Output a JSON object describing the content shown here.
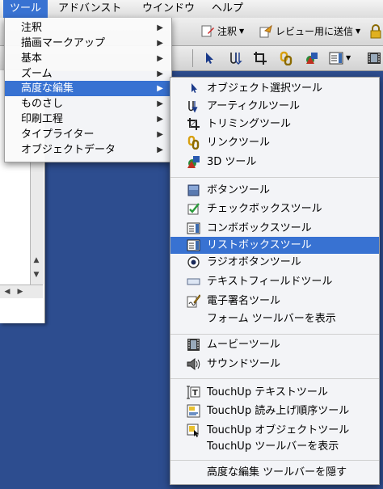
{
  "menubar": {
    "items": [
      {
        "label": "ツール"
      },
      {
        "label": "アドバンスト"
      },
      {
        "label": "ウインドウ"
      },
      {
        "label": "ヘルプ"
      }
    ]
  },
  "toolbar": {
    "annotations_label": "注釈",
    "send_review_label": "レビュー用に送信"
  },
  "tools_menu": {
    "items": [
      {
        "label": "注釈"
      },
      {
        "label": "描画マークアップ"
      },
      {
        "label": "基本"
      },
      {
        "label": "ズーム"
      },
      {
        "label": "高度な編集"
      },
      {
        "label": "ものさし"
      },
      {
        "label": "印刷工程"
      },
      {
        "label": "タイプライター"
      },
      {
        "label": "オブジェクトデータ"
      }
    ]
  },
  "advanced_editing_submenu": {
    "group1": [
      {
        "label": "オブジェクト選択ツール",
        "icon": "object-select-icon"
      },
      {
        "label": "アーティクルツール",
        "icon": "article-icon"
      },
      {
        "label": "トリミングツール",
        "icon": "crop-icon"
      },
      {
        "label": "リンクツール",
        "icon": "link-icon"
      },
      {
        "label": "3D ツール",
        "icon": "3d-icon"
      }
    ],
    "group2": [
      {
        "label": "ボタンツール",
        "icon": "button-tool-icon"
      },
      {
        "label": "チェックボックスツール",
        "icon": "checkbox-tool-icon"
      },
      {
        "label": "コンボボックスツール",
        "icon": "combobox-tool-icon"
      },
      {
        "label": "リストボックスツール",
        "icon": "listbox-tool-icon"
      },
      {
        "label": "ラジオボタンツール",
        "icon": "radio-button-tool-icon"
      },
      {
        "label": "テキストフィールドツール",
        "icon": "text-field-tool-icon"
      },
      {
        "label": "電子署名ツール",
        "icon": "digital-signature-icon"
      },
      {
        "label": "フォーム ツールバーを表示"
      }
    ],
    "group3": [
      {
        "label": "ムービーツール",
        "icon": "movie-icon"
      },
      {
        "label": "サウンドツール",
        "icon": "sound-icon"
      }
    ],
    "group4": [
      {
        "label": "TouchUp テキストツール",
        "icon": "touchup-text-icon"
      },
      {
        "label": "TouchUp 読み上げ順序ツール",
        "icon": "touchup-reading-order-icon"
      },
      {
        "label": "TouchUp オブジェクトツール",
        "icon": "touchup-object-icon"
      },
      {
        "label": "TouchUp  ツールバーを表示"
      }
    ],
    "group5": [
      {
        "label": "高度な編集 ツールバーを隠す"
      }
    ]
  },
  "colors": {
    "highlight": "#3872d2",
    "desktop": "#2d4d8f"
  }
}
